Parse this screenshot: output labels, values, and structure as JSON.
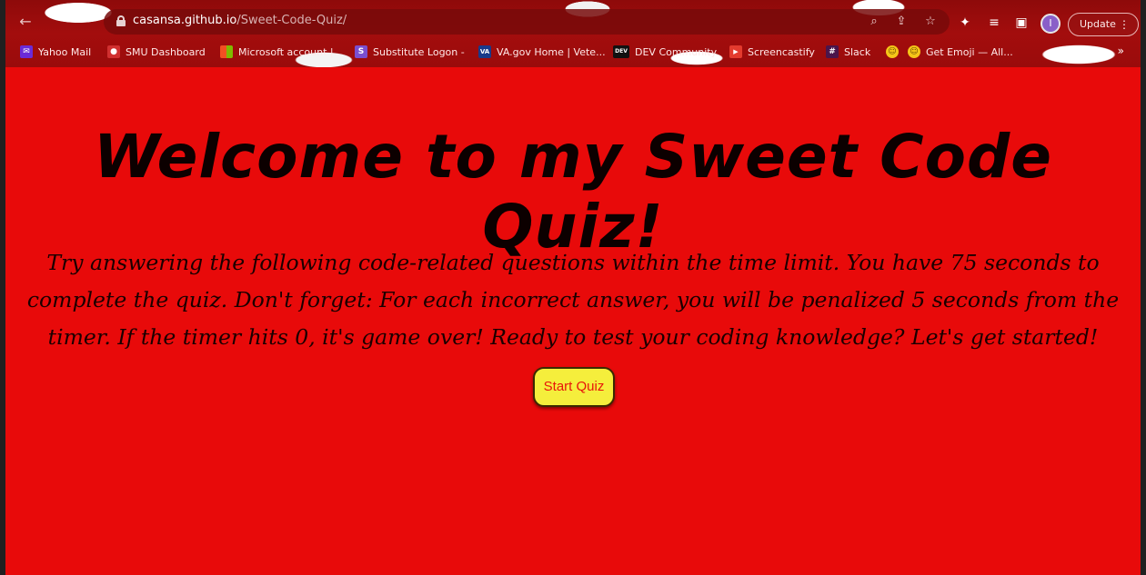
{
  "browser": {
    "url_host": "casansa.github.io",
    "url_path": "/Sweet-Code-Quiz/",
    "avatar_initial": "I",
    "update_label": "Update",
    "bookmarks": [
      {
        "label": "Yahoo Mail",
        "color": "#6a2bd8",
        "icon": "yahoo-icon",
        "glyph": "✉"
      },
      {
        "label": "SMU Dashboard",
        "color": "#d03030",
        "icon": "smu-icon",
        "glyph": "●"
      },
      {
        "label": "Microsoft account |...",
        "color": "#f25022",
        "icon": "microsoft-icon",
        "glyph": "■"
      },
      {
        "label": "Substitute Logon -",
        "color": "#7a4fd0",
        "icon": "substitute-icon",
        "glyph": "S"
      },
      {
        "label": "VA.gov Home | Vete...",
        "color": "#1a3a8a",
        "icon": "va-icon",
        "glyph": "VA"
      },
      {
        "label": "DEV Community",
        "color": "#111111",
        "icon": "dev-icon",
        "glyph": "DEV"
      },
      {
        "label": "Screencastify",
        "color": "#e33b2e",
        "icon": "screencastify-icon",
        "glyph": "▶"
      },
      {
        "label": "Slack",
        "color": "#4a154b",
        "icon": "slack-icon",
        "glyph": "#"
      },
      {
        "label": "",
        "color": "#f5c518",
        "icon": "emoji-icon",
        "glyph": "☺"
      },
      {
        "label": "Get Emoji — All...",
        "color": "#f5c518",
        "icon": "emoji-icon",
        "glyph": "☺"
      }
    ]
  },
  "page": {
    "heading": "Welcome to my Sweet Code Quiz!",
    "intro": "Try answering the following code-related questions within the time limit. You have 75 seconds to complete the quiz. Don't forget: For each incorrect answer, you will be penalized 5 seconds from the timer. If the timer hits 0, it's game over! Ready to test your coding knowledge? Let's get started!",
    "start_button": "Start Quiz",
    "background_color": "#e80a0a",
    "button_color": "#f5ee3c"
  }
}
